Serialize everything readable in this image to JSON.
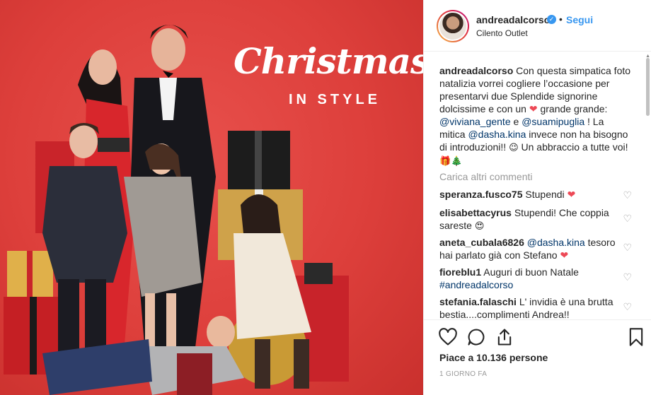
{
  "photo": {
    "brand_script": "Christmas",
    "brand_sub": "IN STYLE"
  },
  "header": {
    "username": "andreadalcorso",
    "verified_glyph": "✓",
    "dot": "•",
    "follow_label": "Segui",
    "location": "Cilento Outlet"
  },
  "caption": {
    "username": "andreadalcorso",
    "text_1": "Con questa simpatica foto natalizia vorrei cogliere l’occasione per presentarvi due Splendide signorine dolcissime e con un",
    "heart": "❤",
    "text_2": "grande grande:",
    "mention_1": "@viviana_gente",
    "and": "e",
    "mention_2": "@suamipuglia",
    "text_3": "! La mitica",
    "mention_3": "@dasha.kina",
    "text_4": "invece non ha bisogno di introduzioni!!",
    "wink_emoji": "😉",
    "text_5": "Un abbraccio a tutte voi!",
    "end_emojis": "🎁🎄"
  },
  "load_more_label": "Carica altri commenti",
  "comments": [
    {
      "user": "speranza.fusco75",
      "text": "Stupendi",
      "emoji": "❤"
    },
    {
      "user": "elisabettacyrus",
      "text": "Stupendi! Che coppia sareste",
      "emoji": "😍"
    },
    {
      "user": "aneta_cubala6826",
      "mention": "@dasha.kina",
      "text": "tesoro hai parlato già con Stefano",
      "emoji": "❤"
    },
    {
      "user": "fioreblu1",
      "text": "Auguri di buon Natale",
      "tag": "#andreadalcorso"
    },
    {
      "user": "stefania.falaschi",
      "text": "L' invidia è una brutta bestia....complimenti Andrea!!"
    }
  ],
  "comment_like_glyph": "♡",
  "actions": {
    "likes_label": "Piace a 10.136 persone",
    "timestamp": "1 GIORNO FA",
    "icons": [
      "heart-outline-icon",
      "comment-icon",
      "share-icon",
      "bookmark-icon"
    ]
  },
  "colors": {
    "link_blue": "#3897f0",
    "mention_navy": "#003569",
    "heart_red": "#ed4956",
    "photo_red": "#dd3f3b"
  }
}
